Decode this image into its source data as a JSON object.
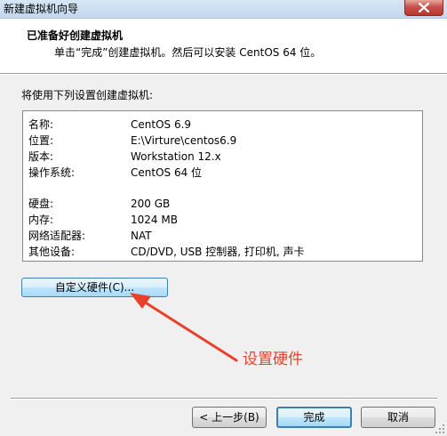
{
  "window": {
    "title": "新建虚拟机向导"
  },
  "header": {
    "title": "已准备好创建虚拟机",
    "subtitle": "单击“完成”创建虚拟机。然后可以安装 CentOS 64 位。"
  },
  "intro": "将使用下列设置创建虚拟机:",
  "summary": [
    {
      "label": "名称:",
      "value": "CentOS 6.9"
    },
    {
      "label": "位置:",
      "value": "E:\\Virture\\centos6.9"
    },
    {
      "label": "版本:",
      "value": "Workstation 12.x"
    },
    {
      "label": "操作系统:",
      "value": "CentOS 64 位"
    },
    {
      "label": "硬盘:",
      "value": "200 GB"
    },
    {
      "label": "内存:",
      "value": "1024 MB"
    },
    {
      "label": "网络适配器:",
      "value": "NAT"
    },
    {
      "label": "其他设备:",
      "value": "CD/DVD, USB 控制器, 打印机, 声卡"
    }
  ],
  "buttons": {
    "customize": "自定义硬件(C)...",
    "back": "< 上一步(B)",
    "finish": "完成",
    "cancel": "取消"
  },
  "annotation": {
    "text": "设置硬件",
    "color": "#e8412b"
  },
  "icons": {
    "close": "close-icon",
    "arrow": "annotation-arrow",
    "resize": "resize-grip-icon"
  }
}
